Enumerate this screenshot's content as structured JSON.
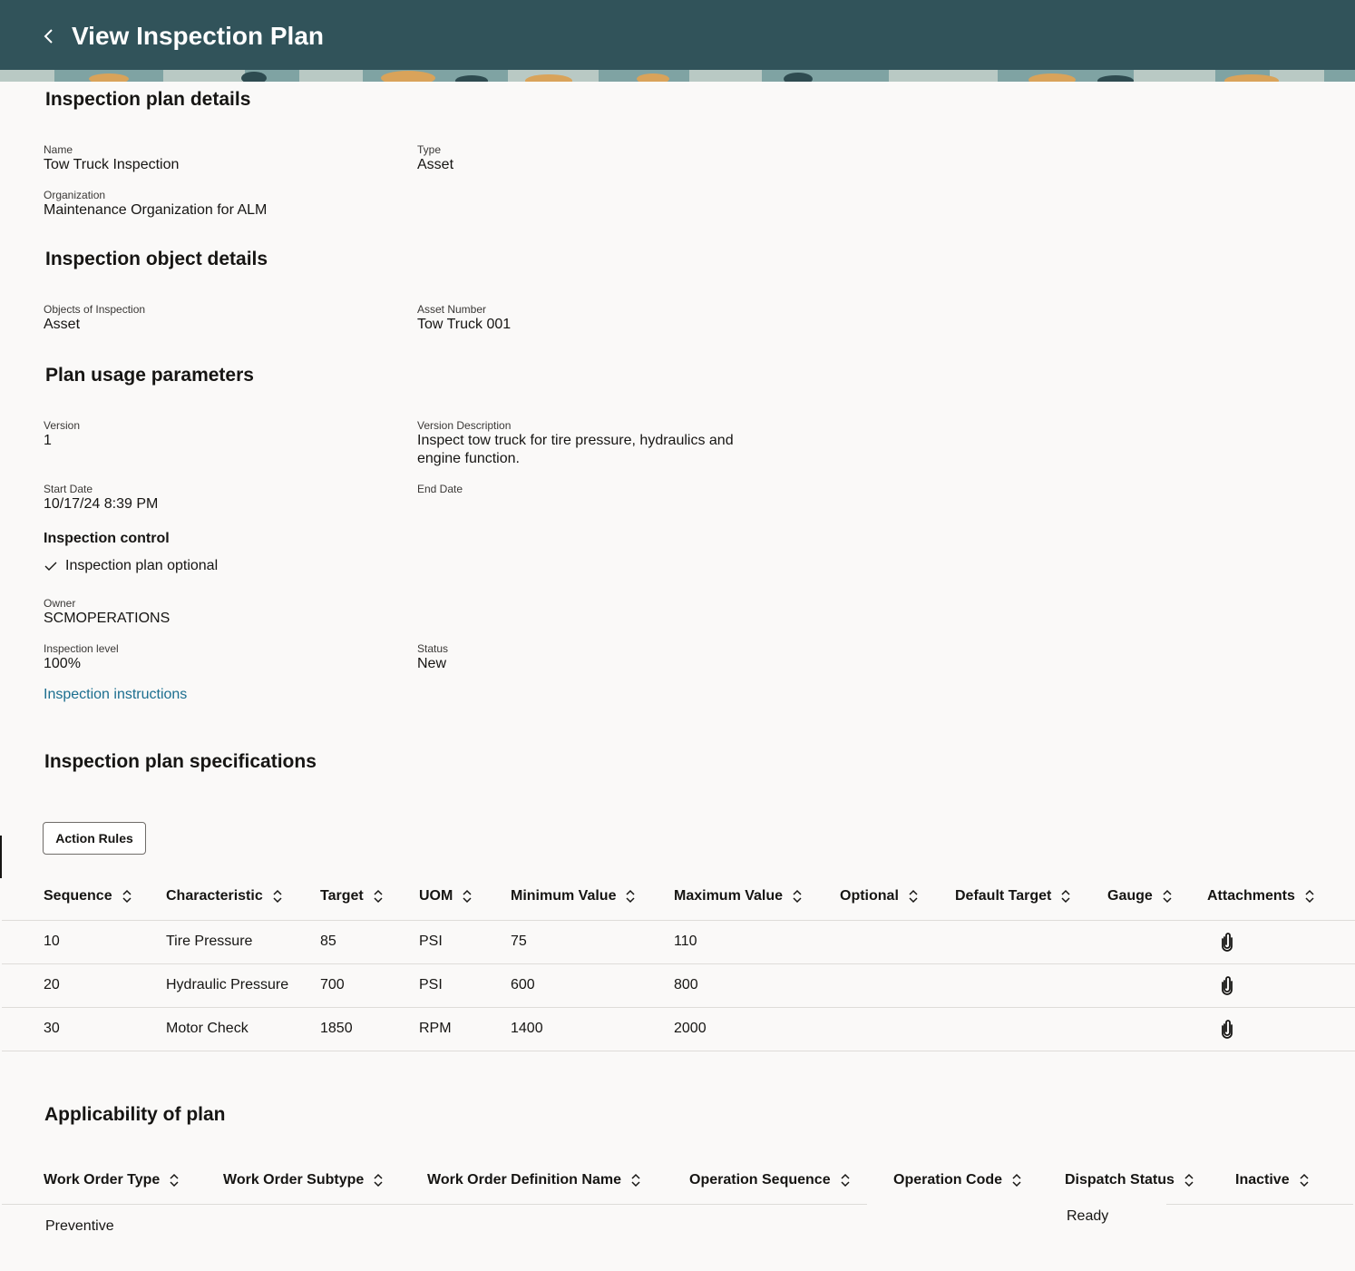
{
  "header": {
    "title": "View Inspection Plan",
    "back_icon": "chevron-left-icon",
    "background": "#31535a"
  },
  "plan_details": {
    "title": "Inspection plan details",
    "name_label": "Name",
    "name_value": "Tow Truck Inspection",
    "type_label": "Type",
    "type_value": "Asset",
    "org_label": "Organization",
    "org_value": "Maintenance Organization for ALM"
  },
  "object_details": {
    "title": "Inspection object details",
    "objects_label": "Objects of Inspection",
    "objects_value": "Asset",
    "asset_number_label": "Asset Number",
    "asset_number_value": "Tow Truck 001"
  },
  "usage": {
    "title": "Plan usage parameters",
    "version_label": "Version",
    "version_value": "1",
    "version_desc_label": "Version Description",
    "version_desc_line1": "Inspect tow truck for tire pressure, hydraulics and",
    "version_desc_line2": "engine function.",
    "start_date_label": "Start Date",
    "start_date_value": "10/17/24 8:39 PM",
    "end_date_label": "End Date",
    "control_title": "Inspection control",
    "optional_text": "Inspection plan optional",
    "owner_label": "Owner",
    "owner_value": "SCMOPERATIONS",
    "level_label": "Inspection level",
    "level_value": "100%",
    "status_label": "Status",
    "status_value": "New",
    "instructions_link": "Inspection instructions"
  },
  "specifications": {
    "title": "Inspection plan specifications",
    "action_rules_label": "Action Rules",
    "columns": [
      "Sequence",
      "Characteristic",
      "Target",
      "UOM",
      "Minimum Value",
      "Maximum Value",
      "Optional",
      "Default Target",
      "Gauge",
      "Attachments"
    ],
    "rows": [
      {
        "sequence": "10",
        "characteristic": "Tire Pressure",
        "target": "85",
        "uom": "PSI",
        "min": "75",
        "max": "110"
      },
      {
        "sequence": "20",
        "characteristic": "Hydraulic Pressure",
        "target": "700",
        "uom": "PSI",
        "min": "600",
        "max": "800"
      },
      {
        "sequence": "30",
        "characteristic": "Motor Check",
        "target": "1850",
        "uom": "RPM",
        "min": "1400",
        "max": "2000"
      }
    ],
    "attachment_icon": "paperclip-icon",
    "sort_icon": "sort-icon"
  },
  "applicability": {
    "title": "Applicability of plan",
    "columns": [
      "Work Order Type",
      "Work Order Subtype",
      "Work Order Definition Name",
      "Operation Sequence",
      "Operation Code",
      "Dispatch Status",
      "Inactive"
    ],
    "row": {
      "work_order_type": "Preventive",
      "dispatch_status": "Ready"
    }
  }
}
